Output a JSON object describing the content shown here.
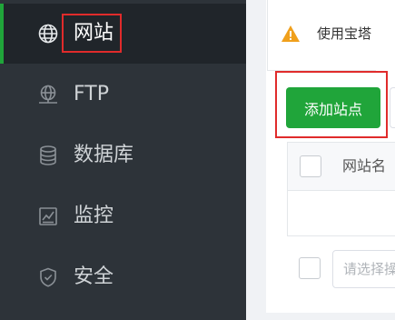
{
  "sidebar": {
    "items": [
      {
        "label": "网站",
        "icon": "globe-icon",
        "active": true
      },
      {
        "label": "FTP",
        "icon": "ftp-globe-icon",
        "active": false
      },
      {
        "label": "数据库",
        "icon": "database-icon",
        "active": false
      },
      {
        "label": "监控",
        "icon": "monitor-chart-icon",
        "active": false
      },
      {
        "label": "安全",
        "icon": "shield-check-icon",
        "active": false
      }
    ]
  },
  "main": {
    "notice": {
      "icon": "warning-icon",
      "text": "使用宝塔"
    },
    "add_site_button": "添加站点",
    "table": {
      "header_name": "网站名"
    },
    "bulk_select_placeholder": "请选择操作"
  },
  "colors": {
    "sidebar_bg": "#2d3339",
    "sidebar_active_bg": "#20252a",
    "accent_green": "#20a53a",
    "highlight_red": "#e02b2b",
    "warning_orange": "#f0a01c"
  }
}
